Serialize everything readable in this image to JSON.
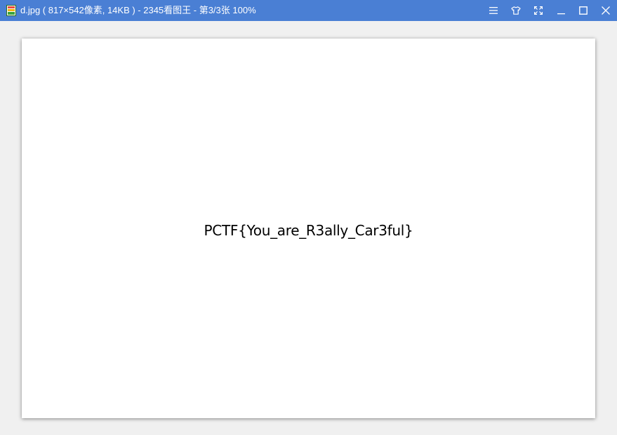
{
  "window": {
    "title": "d.jpg ( 817×542像素, 14KB ) - 2345看图王 - 第3/3张 100%",
    "app_icon": "image-viewer-app-icon",
    "controls": [
      {
        "name": "menu-icon"
      },
      {
        "name": "skin-icon"
      },
      {
        "name": "fullscreen-icon"
      },
      {
        "name": "minimize-icon"
      },
      {
        "name": "maximize-icon"
      },
      {
        "name": "close-icon"
      }
    ]
  },
  "image": {
    "text": "PCTF{You_are_R3ally_Car3ful}"
  },
  "colors": {
    "titlebar": "#4a7fd4",
    "background": "#f0f0f0",
    "image_background": "#ffffff"
  }
}
